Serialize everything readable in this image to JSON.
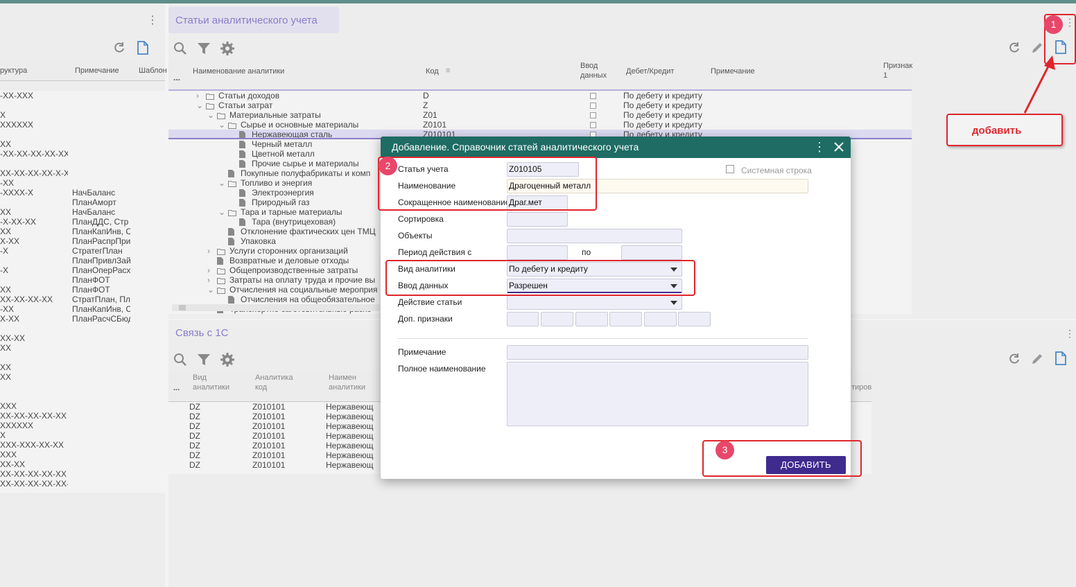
{
  "left": {
    "headers": [
      "руктура",
      "Примечание",
      "Шаблон"
    ],
    "rows": [
      [
        "-XX-XXX",
        ""
      ],
      [
        "",
        ""
      ],
      [
        "X",
        ""
      ],
      [
        "XXXXXX",
        ""
      ],
      [
        "",
        ""
      ],
      [
        "XX",
        ""
      ],
      [
        "-XX-XX-XX-XX-XX",
        ""
      ],
      [
        "",
        ""
      ],
      [
        "XX-XX-XX-XX-X-X",
        ""
      ],
      [
        "-XX",
        ""
      ],
      [
        "-XXXX-X",
        "НачБаланс"
      ],
      [
        "",
        "ПланАморт"
      ],
      [
        "XX",
        "НачБаланс"
      ],
      [
        "-X-XX-XX",
        "ПланДДС, Стр"
      ],
      [
        "XX",
        "ПланКапИнв, С"
      ],
      [
        "X-XX",
        "ПланРаспрПри"
      ],
      [
        "-X",
        "СтратегПлан"
      ],
      [
        "",
        "ПланПривлЗай"
      ],
      [
        "-X",
        "ПланОперРасх"
      ],
      [
        "",
        "ПланФОТ"
      ],
      [
        "XX",
        "ПланФОТ"
      ],
      [
        "XX-XX-XX-XX",
        "СтратПлан, Пл"
      ],
      [
        "-XX",
        "ПланКапИнв, С"
      ],
      [
        "X-XX",
        "ПланРасчСБюд"
      ],
      [
        "",
        ""
      ],
      [
        "XX-XX",
        ""
      ],
      [
        "XX",
        ""
      ],
      [
        "",
        ""
      ],
      [
        "XX",
        ""
      ],
      [
        "XX",
        ""
      ],
      [
        "",
        ""
      ],
      [
        "",
        ""
      ],
      [
        "XXX",
        ""
      ],
      [
        "XX-XX-XX-XX-XX",
        ""
      ],
      [
        "XXXXXX",
        ""
      ],
      [
        "X",
        ""
      ],
      [
        "XXX-XXX-XX-XX",
        ""
      ],
      [
        "XXX",
        ""
      ],
      [
        "XX-XX",
        ""
      ],
      [
        "XX-XX-XX-XX-XX",
        ""
      ],
      [
        "XX-XX-XX-XX-XX-X",
        ""
      ]
    ]
  },
  "main": {
    "title": "Статьи аналитического учета",
    "headers": {
      "name": "Наименование аналитики",
      "code": "Код",
      "input": "Ввод\nданных",
      "input1": "Ввод",
      "input2": "данных",
      "debit": "Дебет/Кредит",
      "note": "Примечание",
      "sign": "Признак",
      "sign_num": "1"
    },
    "ellipsis": "...",
    "rows": [
      {
        "indent": 0,
        "arrow": "›",
        "folder": true,
        "name": "Статьи доходов",
        "code": "D",
        "dk": "По дебету и кредиту"
      },
      {
        "indent": 0,
        "arrow": "⌄",
        "folder": true,
        "name": "Статьи затрат",
        "code": "Z",
        "dk": "По дебету и кредиту"
      },
      {
        "indent": 1,
        "arrow": "⌄",
        "folder": true,
        "name": "Материальные затраты",
        "code": "Z01",
        "dk": "По дебету и кредиту"
      },
      {
        "indent": 2,
        "arrow": "⌄",
        "folder": true,
        "name": "Сырье и основные материалы",
        "code": "Z0101",
        "dk": "По дебету и кредиту"
      },
      {
        "indent": 3,
        "arrow": "",
        "folder": false,
        "name": "Нержавеющая сталь",
        "code": "Z010101",
        "dk": "По дебету и кредиту"
      },
      {
        "indent": 3,
        "arrow": "",
        "folder": false,
        "name": "Черный металл",
        "code": "",
        "dk": ""
      },
      {
        "indent": 3,
        "arrow": "",
        "folder": false,
        "name": "Цветной металл",
        "code": "",
        "dk": ""
      },
      {
        "indent": 3,
        "arrow": "",
        "folder": false,
        "name": "Прочие сырье и материалы",
        "code": "",
        "dk": ""
      },
      {
        "indent": 2,
        "arrow": "",
        "folder": false,
        "name": "Покупные полуфабрикаты и комп",
        "code": "",
        "dk": ""
      },
      {
        "indent": 2,
        "arrow": "⌄",
        "folder": true,
        "name": "Топливо и энергия",
        "code": "",
        "dk": ""
      },
      {
        "indent": 3,
        "arrow": "",
        "folder": false,
        "name": "Электроэнергия",
        "code": "",
        "dk": ""
      },
      {
        "indent": 3,
        "arrow": "",
        "folder": false,
        "name": "Природный газ",
        "code": "",
        "dk": ""
      },
      {
        "indent": 2,
        "arrow": "⌄",
        "folder": true,
        "name": "Тара и тарные материалы",
        "code": "",
        "dk": ""
      },
      {
        "indent": 3,
        "arrow": "",
        "folder": false,
        "name": "Тара (внутрицеховая)",
        "code": "",
        "dk": ""
      },
      {
        "indent": 2,
        "arrow": "",
        "folder": false,
        "name": "Отклонение фактических цен ТМЦ",
        "code": "",
        "dk": ""
      },
      {
        "indent": 2,
        "arrow": "",
        "folder": false,
        "name": "Упаковка",
        "code": "",
        "dk": ""
      },
      {
        "indent": 1,
        "arrow": "›",
        "folder": true,
        "name": "Услуги сторонних организаций",
        "code": "",
        "dk": ""
      },
      {
        "indent": 1,
        "arrow": "",
        "folder": false,
        "name": "Возвратные и деловые отходы",
        "code": "",
        "dk": ""
      },
      {
        "indent": 1,
        "arrow": "›",
        "folder": true,
        "name": "Общепроизводственные затраты",
        "code": "",
        "dk": ""
      },
      {
        "indent": 1,
        "arrow": "›",
        "folder": true,
        "name": "Затраты на оплату труда и прочие вы",
        "code": "",
        "dk": ""
      },
      {
        "indent": 1,
        "arrow": "⌄",
        "folder": true,
        "name": "Отчисления на социальные мероприя",
        "code": "",
        "dk": ""
      },
      {
        "indent": 2,
        "arrow": "",
        "folder": false,
        "name": "Отчисления на общеобязательное",
        "code": "",
        "dk": ""
      },
      {
        "indent": 1,
        "arrow": "",
        "folder": false,
        "name": "Транспортно-заготовительные расхо",
        "code": "",
        "dk": ""
      }
    ]
  },
  "link": {
    "title": "Связь с 1С",
    "headers": {
      "type1": "Вид",
      "type2": "аналитики",
      "code1": "Аналитика",
      "code2": "код",
      "name1": "Наимен",
      "name2": "аналитики",
      "extra": "тиров"
    },
    "ellipsis": "...",
    "rows": [
      [
        "DZ",
        "Z010101",
        "Нержавеющ"
      ],
      [
        "DZ",
        "Z010101",
        "Нержавеющ"
      ],
      [
        "DZ",
        "Z010101",
        "Нержавеющ"
      ],
      [
        "DZ",
        "Z010101",
        "Нержавеющ"
      ],
      [
        "DZ",
        "Z010101",
        "Нержавеющ"
      ],
      [
        "DZ",
        "Z010101",
        "Нержавеющ"
      ],
      [
        "DZ",
        "Z010101",
        "Нержавеющ"
      ]
    ]
  },
  "modal": {
    "title": "Добавление. Справочник статей аналитического учета",
    "system_row": "Системная строка",
    "labels": {
      "article": "Статья учета",
      "name": "Наименование",
      "short": "Сокращенное наименование",
      "sort": "Сортировка",
      "objects": "Объекты",
      "period": "Период действия с",
      "period_to": "по",
      "kind": "Вид аналитики",
      "input": "Ввод данных",
      "action": "Действие статьи",
      "extra": "Доп. признаки",
      "note": "Примечание",
      "full": "Полное наименование"
    },
    "values": {
      "article": "Z010105",
      "name": "Драгоценный металл",
      "short": "Драг.мет",
      "kind": "По дебету и кредиту",
      "input": "Разрешен",
      "action": ""
    },
    "add_button": "ДОБАВИТЬ"
  },
  "annotations": {
    "badge1": "1",
    "badge2": "2",
    "badge3": "3",
    "callout": "добавить",
    "red": "#e0252c",
    "badge_color": "#e8476a"
  },
  "colors": {
    "header": "#1e6c64",
    "button": "#3f2b8e",
    "accent_title": "#8a7cc8"
  },
  "icons": [
    "search-icon",
    "filter-icon",
    "gear-icon",
    "refresh-icon",
    "edit-icon",
    "new-document-icon",
    "kebab-icon",
    "close-icon",
    "folder-icon",
    "document-icon"
  ]
}
